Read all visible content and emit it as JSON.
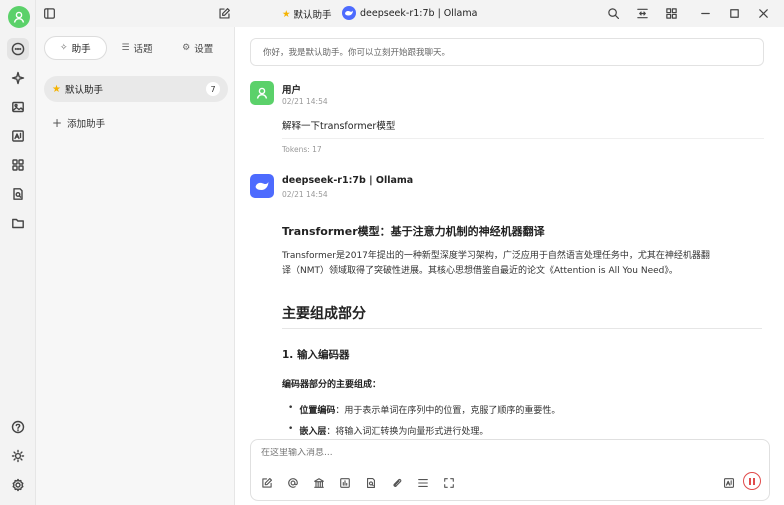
{
  "titlebar": {
    "assistant_name": "默认助手",
    "model_label": "deepseek-r1:7b | Ollama"
  },
  "sidebar": {
    "tabs": [
      {
        "label": "助手",
        "icon": "sparkle-icon"
      },
      {
        "label": "话题",
        "icon": "list-icon"
      },
      {
        "label": "设置",
        "icon": "gear-icon"
      }
    ],
    "assistant": {
      "name": "默认助手",
      "count": "7"
    },
    "add_label": "添加助手"
  },
  "chat": {
    "greeting": "你好，我是默认助手。你可以立刻开始跟我聊天。",
    "user_msg": {
      "name": "用户",
      "time": "02/21 14:54",
      "text": "解释一下transformer模型",
      "tokens": "Tokens: 17"
    },
    "bot_msg": {
      "name": "deepseek-r1:7b | Ollama",
      "time": "02/21 14:54",
      "heading": "Transformer模型：基于注意力机制的神经机器翻译",
      "para1_line1": "Transformer是2017年提出的一种新型深度学习架构，广泛应用于自然语言处理任务中，尤其在神经机器翻",
      "para1_line2": "译（NMT）领域取得了突破性进展。其核心思想借鉴自最近的论文《Attention is All You Need》。",
      "section_title": "主要组成部分",
      "subsection_title": "1. 输入编码器",
      "sub_label": "编码器部分的主要组成：",
      "bullets": [
        {
          "term": "位置编码",
          "desc": "：用于表示单词在序列中的位置，克服了顺序的重要性。"
        },
        {
          "term": "嵌入层",
          "desc": "：将输入词汇转换为向量形式进行处理。"
        }
      ]
    }
  },
  "input": {
    "placeholder": "在这里输入消息..."
  },
  "colors": {
    "user_avatar": "#5bd16a",
    "model_badge": "#4d6bfe",
    "stop": "#e14b4b",
    "star": "#f5b301"
  }
}
